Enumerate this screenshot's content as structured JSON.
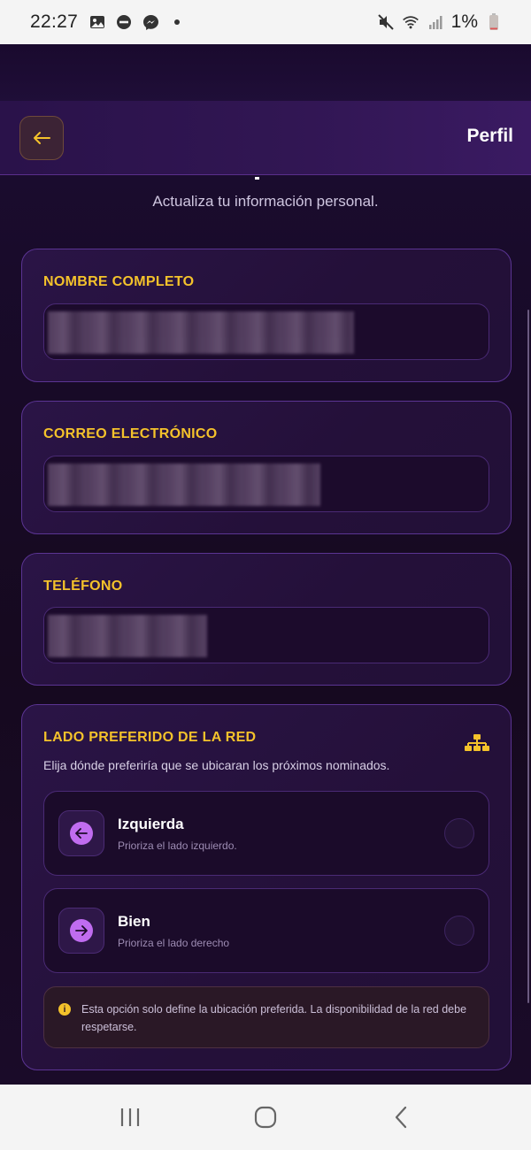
{
  "status_bar": {
    "time": "22:27",
    "battery": "1%",
    "icons": [
      "image-icon",
      "do-not-disturb-icon",
      "messenger-icon",
      "dot-icon",
      "mute-icon",
      "wifi-icon",
      "signal-icon",
      "battery-icon"
    ]
  },
  "header": {
    "title": "Perfil",
    "back_icon": "arrow-left-icon"
  },
  "subtitle": "Actualiza tu información personal.",
  "fields": {
    "name": {
      "label": "NOMBRE COMPLETO",
      "value": ""
    },
    "email": {
      "label": "CORREO ELECTRÓNICO",
      "value": ""
    },
    "phone": {
      "label": "TELÉFONO",
      "value": ""
    }
  },
  "network_side": {
    "label": "LADO PREFERIDO DE LA RED",
    "description": "Elija dónde preferiría que se ubicaran los próximos nominados.",
    "options": [
      {
        "title": "Izquierda",
        "description": "Prioriza el lado izquierdo.",
        "icon": "arrow-left-icon",
        "selected": false
      },
      {
        "title": "Bien",
        "description": "Prioriza el lado derecho",
        "icon": "arrow-right-icon",
        "selected": false
      }
    ],
    "info": "Esta opción solo define la ubicación preferida. La disponibilidad de la red debe respetarse."
  },
  "colors": {
    "accent": "#f4c22b",
    "icon_purple": "#c06cf0",
    "card_border": "#5b3493"
  }
}
